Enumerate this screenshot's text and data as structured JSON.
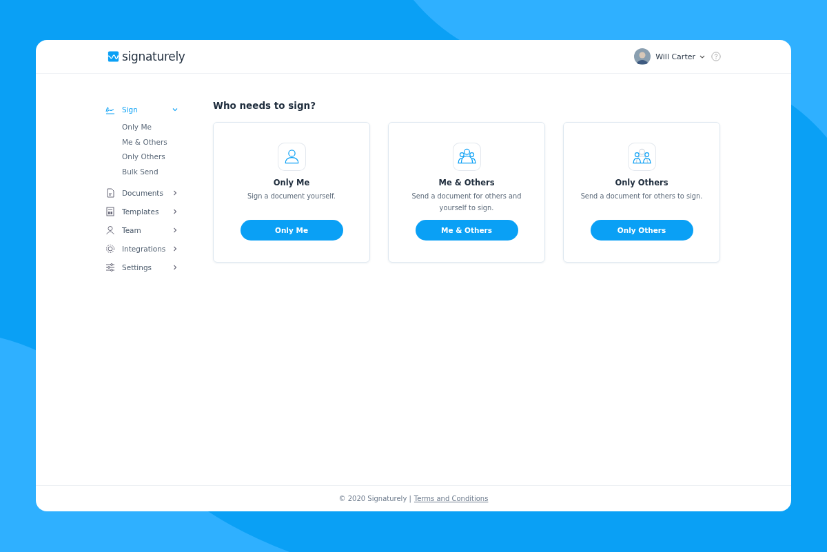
{
  "header": {
    "logo": "signaturely",
    "user": {
      "name": "Will Carter"
    }
  },
  "sidebar": {
    "items": [
      {
        "label": "Sign",
        "selected": true,
        "expanded": true,
        "children": [
          {
            "label": "Only Me"
          },
          {
            "label": "Me & Others"
          },
          {
            "label": "Only Others"
          },
          {
            "label": "Bulk Send"
          }
        ]
      },
      {
        "label": "Documents",
        "selected": false,
        "expanded": false
      },
      {
        "label": "Templates",
        "selected": false,
        "expanded": false
      },
      {
        "label": "Team",
        "selected": false,
        "expanded": false
      },
      {
        "label": "Integrations",
        "selected": false,
        "expanded": false
      },
      {
        "label": "Settings",
        "selected": false,
        "expanded": false
      }
    ]
  },
  "heading": "Who needs to sign?",
  "cards": [
    {
      "title": "Only Me",
      "description": "Sign a document yourself.",
      "button": "Only Me"
    },
    {
      "title": "Me & Others",
      "description": "Send a document for others and yourself to sign.",
      "button": "Me & Others"
    },
    {
      "title": "Only Others",
      "description": "Send a document for others to sign.",
      "button": "Only Others"
    }
  ],
  "footer": {
    "copyright": "© 2020 Signaturely |",
    "link": "Terms and Conditions"
  }
}
